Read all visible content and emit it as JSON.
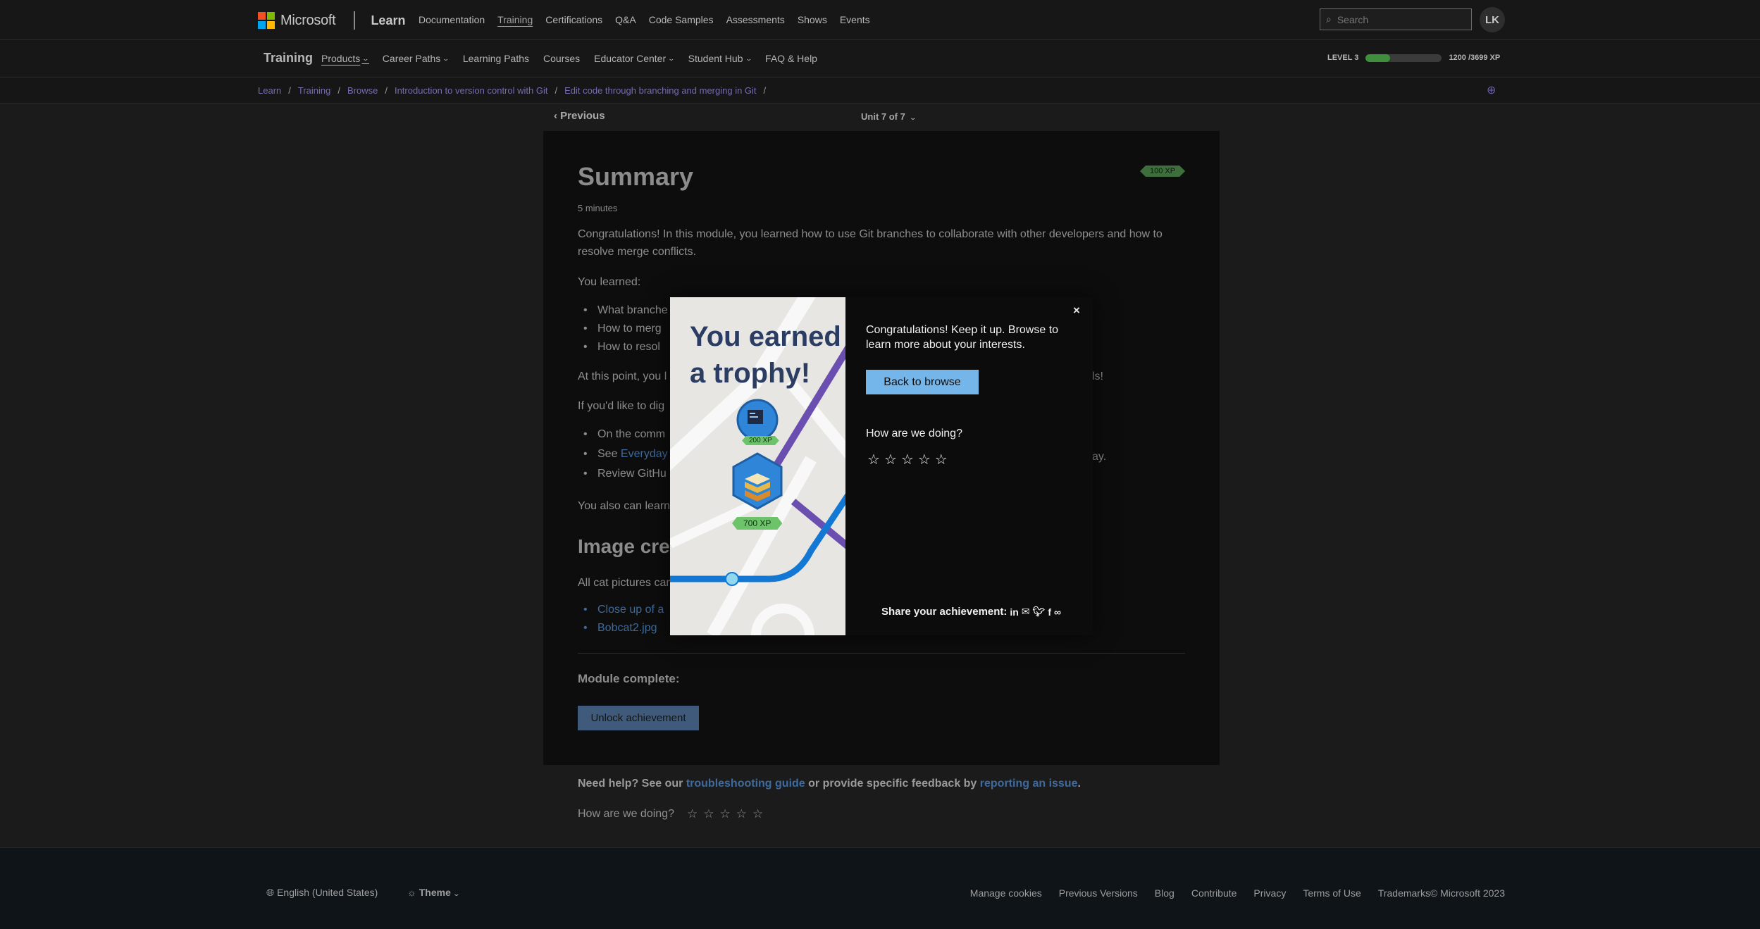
{
  "header": {
    "brand": "Microsoft",
    "product": "Learn",
    "nav": [
      "Documentation",
      "Training",
      "Certifications",
      "Q&A",
      "Code Samples",
      "Assessments",
      "Shows",
      "Events"
    ],
    "search_placeholder": "Search",
    "avatar_initials": "LK"
  },
  "subbar": {
    "title": "Training",
    "nav": [
      "Products",
      "Career Paths",
      "Learning Paths",
      "Courses",
      "Educator Center",
      "Student Hub",
      "FAQ & Help"
    ],
    "level_label": "LEVEL 3",
    "xp_progress": 0.32,
    "xp_text": "1200 /3699 XP"
  },
  "breadcrumb": [
    "Learn",
    "Training",
    "Browse",
    "Introduction to version control with Git",
    "Edit code through branching and merging in Git"
  ],
  "unit_nav": {
    "previous": "Previous",
    "unit": "Unit 7 of 7"
  },
  "article": {
    "title": "Summary",
    "duration": "5 minutes",
    "xp_badge": "100 XP",
    "intro": "Congratulations! In this module, you learned how to use Git branches to collaborate with other developers and how to resolve merge conflicts.",
    "learned_label": "You learned:",
    "learned_items": [
      "What branche",
      "How to merg",
      "How to resol"
    ],
    "at_this_point": "At this point, you l",
    "at_this_point_tail": "ls!",
    "dig_deeper": "If you'd like to dig",
    "more_items": [
      "On the comm",
      "See ",
      "Review GitHu"
    ],
    "see_link": "Everyday",
    "see_tail": "ay.",
    "also_learn": "You also can learn",
    "image_credits_heading": "Image cred",
    "cat_pictures": "All cat pictures can",
    "credit_links": [
      "Close up of a",
      "Bobcat2.jpg"
    ],
    "module_complete": "Module complete:",
    "unlock_button": "Unlock achievement"
  },
  "help": {
    "prefix": "Need help? See our ",
    "troubleshooting": "troubleshooting guide",
    "middle": " or provide specific feedback by ",
    "report": "reporting an issue",
    "suffix": ".",
    "rating_label": "How are we doing?"
  },
  "modal": {
    "art_title": "You earned a trophy!",
    "badge_xp_1": "200 XP",
    "badge_xp_2": "700 XP",
    "close": "×",
    "message": "Congratulations! Keep it up. Browse to learn more about your interests.",
    "back_button": "Back to browse",
    "rating_label": "How are we doing?",
    "share_label": "Share your achievement:"
  },
  "footer": {
    "language": "English (United States)",
    "theme": "Theme",
    "links": [
      "Manage cookies",
      "Previous Versions",
      "Blog",
      "Contribute",
      "Privacy",
      "Terms of Use",
      "Trademarks",
      "© Microsoft 2023"
    ]
  },
  "colors": {
    "ms_red": "#f25022",
    "ms_green": "#7fba00",
    "ms_blue": "#00a4ef",
    "ms_yellow": "#ffb900",
    "accent_button": "#75b6ea",
    "xp_green": "#3f8e3d"
  }
}
